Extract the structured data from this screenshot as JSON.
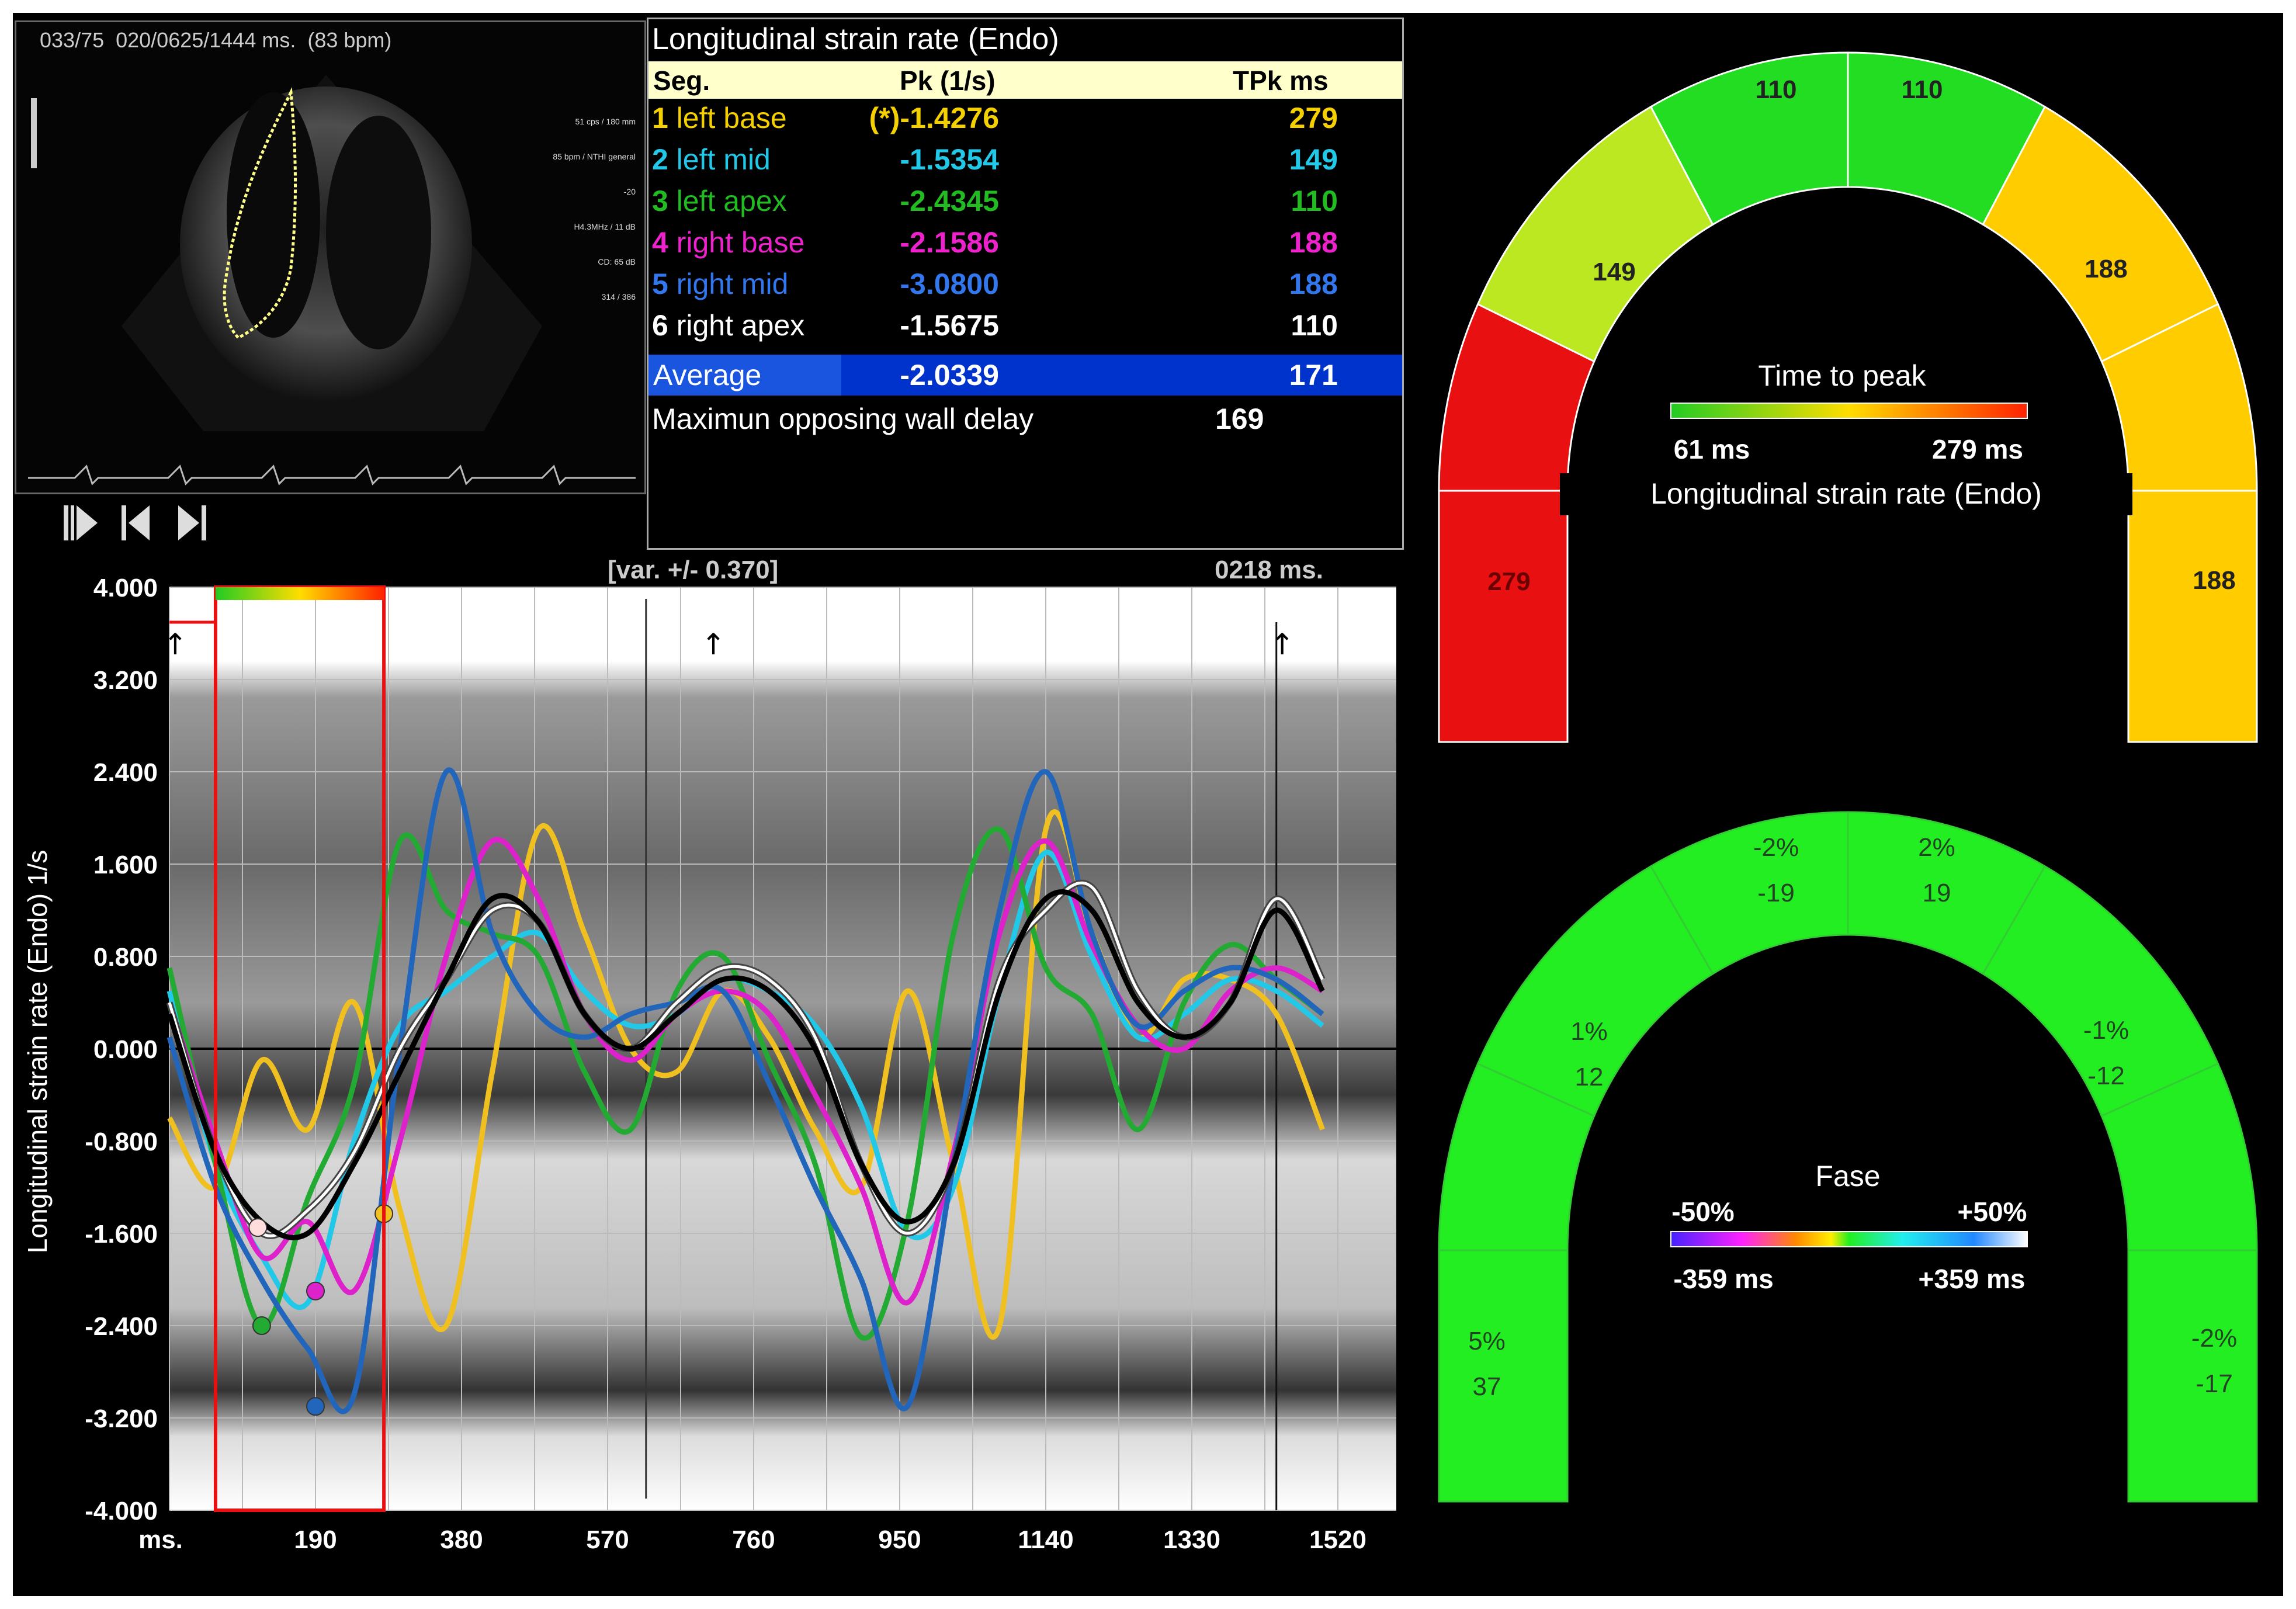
{
  "echo": {
    "header": "033/75  020/0625/1444 ms.  (83 bpm)",
    "info": [
      "51 cps / 180 mm",
      "85 bpm / NTHI general",
      "-20",
      "H4.3MHz / 11 dB",
      "CD: 65 dB",
      "314 / 386"
    ]
  },
  "controls": {
    "play_icon": "play-step-icon",
    "prev_icon": "skip-back-icon",
    "next_icon": "skip-forward-icon"
  },
  "table": {
    "title": "Longitudinal strain rate (Endo)",
    "headers": {
      "seg": "Seg.",
      "pk": "Pk (1/s)",
      "tpk": "TPk ms"
    },
    "rows": [
      {
        "num": "1",
        "seg": "left base",
        "pk": "(*)-1.4276",
        "tpk": "279",
        "color": "#f5d000"
      },
      {
        "num": "2",
        "seg": "left mid",
        "pk": "-1.5354",
        "tpk": "149",
        "color": "#22c8e8"
      },
      {
        "num": "3",
        "seg": "left apex",
        "pk": "-2.4345",
        "tpk": "110",
        "color": "#22bb22"
      },
      {
        "num": "4",
        "seg": "right base",
        "pk": "-2.1586",
        "tpk": "188",
        "color": "#ee22cc"
      },
      {
        "num": "5",
        "seg": "right mid",
        "pk": "-3.0800",
        "tpk": "188",
        "color": "#3377ee"
      },
      {
        "num": "6",
        "seg": "right apex",
        "pk": "-1.5675",
        "tpk": "110",
        "color": "#ffffff"
      }
    ],
    "average": {
      "label": "Average",
      "pk": "-2.0339",
      "tpk": "171"
    },
    "mowd": {
      "label": "Maximun opposing wall delay",
      "value": "169"
    }
  },
  "chart_data": {
    "type": "line",
    "title": "",
    "header_left": "[var. +/- 0.370]",
    "header_right": "0218 ms.",
    "ylabel": "Longitudinal strain rate (Endo)   1/s",
    "xlabel_unit": "ms.",
    "xlim": [
      0,
      1520
    ],
    "ylim": [
      -4,
      4
    ],
    "x_ticks": [
      "190",
      "380",
      "570",
      "760",
      "950",
      "1140",
      "1330",
      "1520"
    ],
    "y_ticks": [
      "4.000",
      "3.200",
      "2.400",
      "1.600",
      "0.800",
      "0.000",
      "-0.800",
      "-1.600",
      "-2.400",
      "-3.200",
      "-4.000"
    ],
    "x": [
      0,
      60,
      120,
      180,
      240,
      300,
      360,
      420,
      480,
      540,
      600,
      660,
      720,
      780,
      840,
      900,
      960,
      1020,
      1080,
      1140,
      1200,
      1260,
      1320,
      1380,
      1440,
      1500
    ],
    "series": [
      {
        "color": "#f0c020",
        "values": [
          -0.6,
          -1.2,
          -0.1,
          -0.7,
          0.4,
          -1.4,
          -2.4,
          -0.2,
          1.9,
          1.0,
          0.0,
          -0.2,
          0.5,
          0.1,
          -0.7,
          -1.2,
          0.5,
          -1.0,
          -2.4,
          1.9,
          1.0,
          0.1,
          0.6,
          0.6,
          0.3,
          -0.7
        ]
      },
      {
        "color": "#22c8e8",
        "values": [
          0.5,
          -1.0,
          -1.8,
          -2.2,
          -0.8,
          0.2,
          0.5,
          0.8,
          1.0,
          0.5,
          0.2,
          0.3,
          0.6,
          0.5,
          0.2,
          -0.5,
          -1.6,
          -1.2,
          0.5,
          1.7,
          0.8,
          0.1,
          0.3,
          0.6,
          0.5,
          0.2
        ]
      },
      {
        "color": "#22aa33",
        "values": [
          0.7,
          -1.0,
          -2.4,
          -1.3,
          -0.3,
          1.8,
          1.2,
          1.0,
          0.8,
          -0.2,
          -0.7,
          0.5,
          0.8,
          -0.1,
          -1.0,
          -2.5,
          -1.5,
          1.0,
          1.9,
          0.7,
          0.3,
          -0.7,
          0.4,
          0.9,
          0.6,
          0.3
        ]
      },
      {
        "color": "#dd22cc",
        "values": [
          0.4,
          -0.8,
          -1.8,
          -1.5,
          -2.1,
          -0.8,
          0.8,
          1.8,
          1.3,
          0.3,
          -0.1,
          0.3,
          0.5,
          0.3,
          -0.4,
          -1.2,
          -2.2,
          -0.9,
          1.0,
          1.8,
          0.9,
          0.2,
          0.0,
          0.5,
          0.7,
          0.5
        ]
      },
      {
        "color": "#2266bb",
        "values": [
          0.1,
          -1.2,
          -2.0,
          -2.6,
          -3.0,
          0.0,
          2.4,
          1.0,
          0.3,
          0.1,
          0.3,
          0.4,
          0.5,
          -0.3,
          -1.2,
          -2.0,
          -3.1,
          -1.0,
          1.2,
          2.4,
          1.0,
          0.2,
          0.5,
          0.7,
          0.6,
          0.3
        ]
      },
      {
        "color": "#ffffff",
        "values": [
          0.4,
          -0.9,
          -1.6,
          -1.4,
          -0.9,
          0.0,
          0.6,
          1.2,
          1.1,
          0.3,
          0.0,
          0.4,
          0.7,
          0.6,
          0.1,
          -1.0,
          -1.6,
          -1.0,
          0.6,
          1.2,
          1.4,
          0.5,
          0.1,
          0.4,
          1.3,
          0.6
        ]
      },
      {
        "color": "#000000",
        "values": [
          0.3,
          -0.9,
          -1.5,
          -1.6,
          -1.0,
          -0.2,
          0.6,
          1.3,
          1.1,
          0.3,
          0.0,
          0.3,
          0.6,
          0.5,
          0.0,
          -1.0,
          -1.5,
          -1.0,
          0.5,
          1.3,
          1.2,
          0.4,
          0.1,
          0.4,
          1.2,
          0.5
        ]
      }
    ],
    "markers": [
      {
        "x": 120,
        "y": -2.4,
        "color": "#22aa33"
      },
      {
        "x": 115,
        "y": -1.55,
        "color": "#ffdddd"
      },
      {
        "x": 190,
        "y": -2.1,
        "color": "#dd22cc"
      },
      {
        "x": 190,
        "y": -3.1,
        "color": "#2266bb"
      },
      {
        "x": 279,
        "y": -1.43,
        "color": "#f0c020"
      }
    ],
    "highlight_window": {
      "x_start": 60,
      "x_end": 279
    }
  },
  "gauge_top": {
    "title": "Time to peak",
    "scale_min": "61 ms",
    "scale_max": "279 ms",
    "subtitle": "Longitudinal strain rate (Endo)",
    "segments": [
      {
        "value": "279",
        "color": "#e81010"
      },
      {
        "value": "149",
        "color": "#bbe820"
      },
      {
        "value": "110",
        "color": "#22dd22"
      },
      {
        "value": "110",
        "color": "#22dd22"
      },
      {
        "value": "188",
        "color": "#ffcc00"
      },
      {
        "value": "188",
        "color": "#ffcc00"
      }
    ]
  },
  "gauge_bottom": {
    "title": "Fase",
    "scale_min_pct": "-50%",
    "scale_max_pct": "+50%",
    "scale_min_ms": "-359 ms",
    "scale_max_ms": "+359 ms",
    "segments": [
      {
        "pct": "5%",
        "ms": "37",
        "color": "#22ee22"
      },
      {
        "pct": "1%",
        "ms": "12",
        "color": "#22ee22"
      },
      {
        "pct": "-2%",
        "ms": "-19",
        "color": "#22ee22"
      },
      {
        "pct": "2%",
        "ms": "19",
        "color": "#22ee22"
      },
      {
        "pct": "-1%",
        "ms": "-12",
        "color": "#22ee22"
      },
      {
        "pct": "-2%",
        "ms": "-17",
        "color": "#22ee22"
      }
    ]
  }
}
